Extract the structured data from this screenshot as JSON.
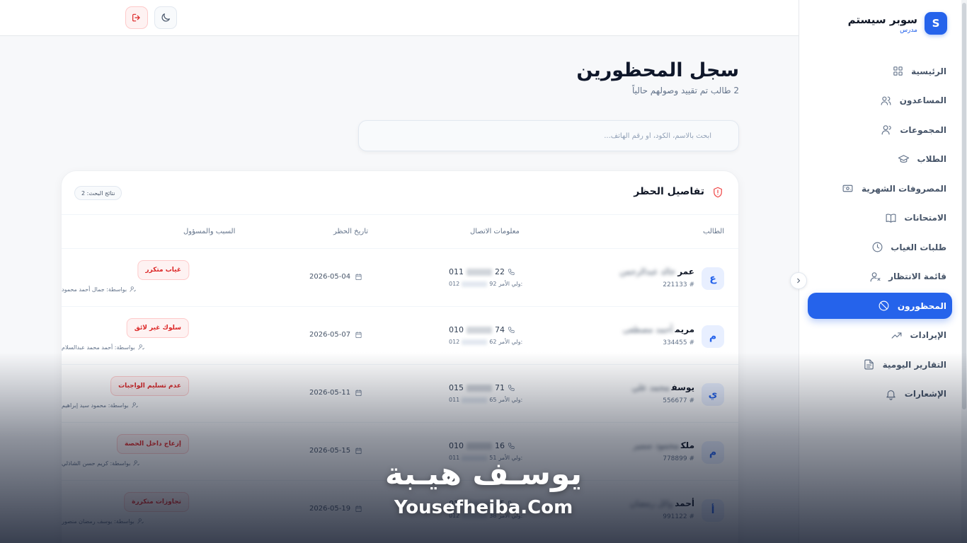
{
  "brand": {
    "name": "سوبر سيستم",
    "role": "مدرس",
    "logo_letter": "S"
  },
  "nav": [
    {
      "label": "الرئيسية",
      "icon": "grid-icon",
      "active": false
    },
    {
      "label": "المساعدون",
      "icon": "users-icon",
      "active": false
    },
    {
      "label": "المجموعات",
      "icon": "group-icon",
      "active": false
    },
    {
      "label": "الطلاب",
      "icon": "graduation-cap-icon",
      "active": false
    },
    {
      "label": "المصروفات الشهرية",
      "icon": "banknote-icon",
      "active": false
    },
    {
      "label": "الامتحانات",
      "icon": "book-icon",
      "active": false
    },
    {
      "label": "طلبات الغياب",
      "icon": "clock-icon",
      "active": false
    },
    {
      "label": "قائمة الانتظار",
      "icon": "user-x-icon",
      "active": false
    },
    {
      "label": "المحظورون",
      "icon": "ban-icon",
      "active": true
    },
    {
      "label": "الإيرادات",
      "icon": "trending-up-icon",
      "active": false
    },
    {
      "label": "التقارير اليومية",
      "icon": "file-text-icon",
      "active": false
    },
    {
      "label": "الإشعارات",
      "icon": "bell-icon",
      "active": false
    }
  ],
  "header": {
    "title": "سجل المحظورين",
    "subtitle": "2 طالب تم تقييد وصولهم حالياً"
  },
  "search": {
    "placeholder": "ابحث بالاسم، الكود، أو رقم الهاتف...",
    "value": ""
  },
  "card": {
    "title": "تفاصيل الحظر",
    "results_badge": "نتائج البحث: 2",
    "columns": [
      "الطالب",
      "معلومات الاتصال",
      "تاريخ الحظر",
      "السبب والمسؤول"
    ]
  },
  "rows": [
    {
      "initial": "ع",
      "first_name": "عمر",
      "rest_name": "خالد عبدالرحمن",
      "code": "# 221133",
      "phone_start": "011",
      "phone_end": "22",
      "parent_label": "ولي الأمر:",
      "parent_start": "012",
      "parent_end": "92",
      "date": "2026-05-04",
      "reason": "غياب متكرر",
      "by": "بواسطة: جمال أحمد محمود"
    },
    {
      "initial": "م",
      "first_name": "مريم",
      "rest_name": "أحمد مصطفى",
      "code": "# 334455",
      "phone_start": "010",
      "phone_end": "74",
      "parent_label": "ولي الأمر:",
      "parent_start": "012",
      "parent_end": "62",
      "date": "2026-05-07",
      "reason": "سلوك غير لائق",
      "by": "بواسطة: أحمد محمد عبدالسلام"
    },
    {
      "initial": "ي",
      "first_name": "يوسف",
      "rest_name": "محمد علي",
      "code": "# 556677",
      "phone_start": "015",
      "phone_end": "71",
      "parent_label": "ولي الأمر:",
      "parent_start": "011",
      "parent_end": "65",
      "date": "2026-05-11",
      "reason": "عدم تسليم الواجبات",
      "by": "بواسطة: محمود سيد إبراهيم"
    },
    {
      "initial": "م",
      "first_name": "ملك",
      "rest_name": "محمود سمير",
      "code": "# 778899",
      "phone_start": "010",
      "phone_end": "16",
      "parent_label": "ولي الأمر:",
      "parent_start": "011",
      "parent_end": "51",
      "date": "2026-05-15",
      "reason": "إزعاج داخل الحصة",
      "by": "بواسطة: كريم حسن الشاذلي"
    },
    {
      "initial": "أ",
      "first_name": "أحمد",
      "rest_name": "وائل رمضان",
      "code": "# 991122",
      "phone_start": "011",
      "phone_end": "15",
      "parent_label": "ولي الأمر:",
      "parent_start": "012",
      "parent_end": "38",
      "date": "2026-05-19",
      "reason": "تجاوزات متكررة",
      "by": "بواسطة: يوسف رمضان منصور"
    }
  ],
  "watermark": {
    "arabic": "يوسـف هيـبة",
    "english": "Yousefheiba.Com"
  },
  "colors": {
    "accent": "#2563eb",
    "danger": "#dc2626",
    "danger_bg": "#fef2f2"
  }
}
